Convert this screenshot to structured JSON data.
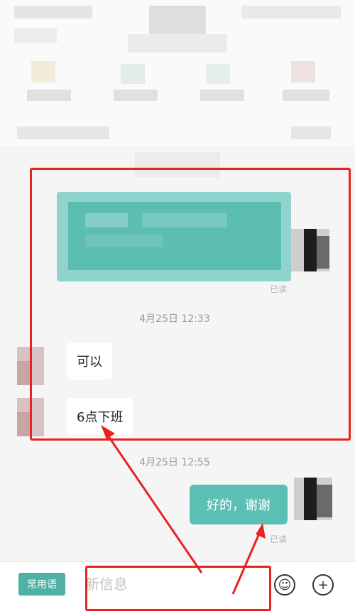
{
  "chat": {
    "sent_card_status": "已读",
    "timestamp_1": "4月25日 12:33",
    "msg_1": "可以",
    "msg_2": "6点下班",
    "timestamp_2": "4月25日 12:55",
    "reply": "好的，谢谢",
    "reply_status": "已读"
  },
  "toolbar": {
    "quick_phrases_label": "常用语",
    "input_placeholder": "新信息",
    "emoji_glyph": "☺",
    "plus_glyph": "+"
  },
  "colors": {
    "accent": "#5bbfb4",
    "annotation": "#e8231f"
  }
}
